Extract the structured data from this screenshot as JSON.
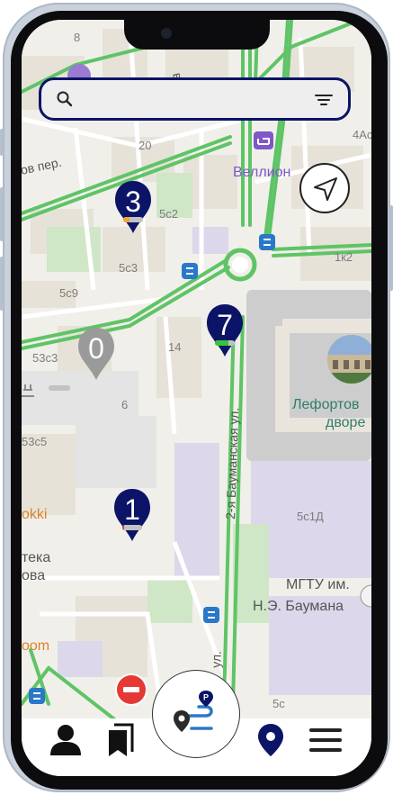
{
  "search": {
    "placeholder": "",
    "value": ""
  },
  "map": {
    "streets": [
      {
        "id": "street-ov-per",
        "text": "ов пер."
      },
      {
        "id": "street-vskaya",
        "text": "вска"
      },
      {
        "id": "street-2ya-baumanskaya",
        "text": "2-я Бауманская ул."
      },
      {
        "id": "street-ul",
        "text": "ул."
      }
    ],
    "places": [
      {
        "id": "place-wellion",
        "text": "Веллион",
        "color": "#7f57c8"
      },
      {
        "id": "place-lefortovo-1",
        "text": "Лефортов",
        "color": "#2f7d6b"
      },
      {
        "id": "place-lefortovo-2",
        "text": "дворе",
        "color": "#2f7d6b"
      },
      {
        "id": "place-mgtu-1",
        "text": "МГТУ им.",
        "color": "#555555"
      },
      {
        "id": "place-mgtu-2",
        "text": "Н.Э. Баумана",
        "color": "#555555"
      },
      {
        "id": "place-okki",
        "text": "okki",
        "color": "#d9822b"
      },
      {
        "id": "place-oom",
        "text": "oom",
        "color": "#d9822b"
      },
      {
        "id": "place-teka",
        "text": "тека",
        "color": "#555555"
      },
      {
        "id": "place-ova",
        "text": "ова",
        "color": "#555555"
      }
    ],
    "house_numbers": [
      {
        "id": "house-8",
        "text": "8"
      },
      {
        "id": "house-20",
        "text": "20"
      },
      {
        "id": "house-4as",
        "text": "4Ас"
      },
      {
        "id": "house-5c2",
        "text": "5с2"
      },
      {
        "id": "house-5c3",
        "text": "5с3"
      },
      {
        "id": "house-5c9",
        "text": "5с9"
      },
      {
        "id": "house-1k2",
        "text": "1к2"
      },
      {
        "id": "house-14",
        "text": "14"
      },
      {
        "id": "house-53c3",
        "text": "53с3"
      },
      {
        "id": "house-6",
        "text": "6"
      },
      {
        "id": "house-53c5",
        "text": "53с5"
      },
      {
        "id": "house-5c1d",
        "text": "5с1Д"
      },
      {
        "id": "house-5c",
        "text": "5с"
      }
    ]
  },
  "pins": [
    {
      "id": "pin-3",
      "number": "3",
      "color": "#0b1466",
      "fill": 0.3,
      "fill_color": "#f2a33a"
    },
    {
      "id": "pin-7",
      "number": "7",
      "color": "#0b1466",
      "fill": 0.7,
      "fill_color": "#35c43d"
    },
    {
      "id": "pin-0",
      "number": "0",
      "color": "#9a9a9a",
      "fill": 0,
      "fill_color": "#9a9a9a"
    },
    {
      "id": "pin-1",
      "number": "1",
      "color": "#0b1466",
      "fill": 0.1,
      "fill_color": "#e53935"
    }
  ],
  "bottom_nav": {
    "items": [
      {
        "id": "profile",
        "icon": "person-icon"
      },
      {
        "id": "bookmarks",
        "icon": "bookmark-icon"
      },
      {
        "id": "route",
        "icon": "route-parking-icon",
        "badge": "P"
      },
      {
        "id": "map",
        "icon": "map-pin-icon"
      },
      {
        "id": "menu",
        "icon": "hamburger-menu-icon"
      }
    ]
  },
  "colors": {
    "accent": "#0b1466",
    "road": "#5ec466",
    "map_bg": "#f1efe9"
  }
}
